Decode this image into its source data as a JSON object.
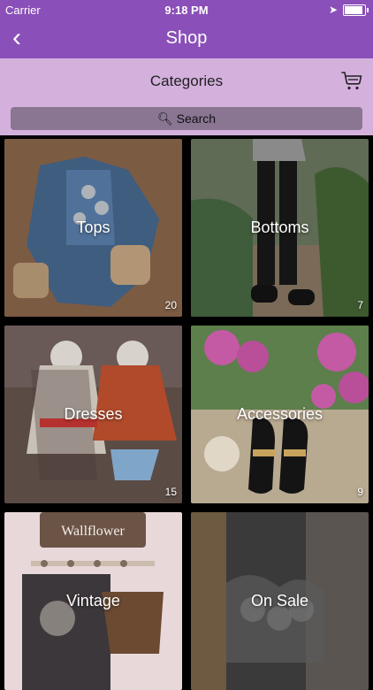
{
  "status": {
    "carrier": "Carrier",
    "time": "9:18 PM"
  },
  "nav": {
    "title": "Shop",
    "back_label": "<"
  },
  "header": {
    "title": "Categories"
  },
  "search": {
    "placeholder": "Search"
  },
  "tiles": [
    {
      "label": "Tops",
      "count": "20"
    },
    {
      "label": "Bottoms",
      "count": "7"
    },
    {
      "label": "Dresses",
      "count": "15"
    },
    {
      "label": "Accessories",
      "count": "9"
    },
    {
      "label": "Vintage",
      "count": ""
    },
    {
      "label": "On Sale",
      "count": ""
    }
  ],
  "colors": {
    "brand": "#8a4fb8",
    "subbar": "#d4b0dd",
    "search_bg": "#8a7693"
  },
  "icons": {
    "back": "chevron-left-icon",
    "cart": "cart-icon",
    "search": "magnifier-icon"
  }
}
